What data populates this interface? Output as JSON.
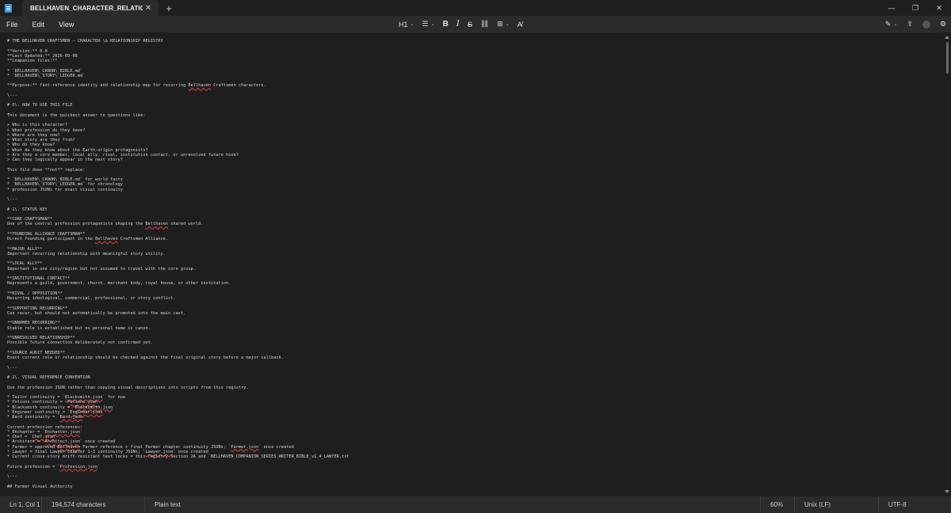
{
  "app": {
    "tab_title": "BELLHAVEN_CHARACTER_RELATIO",
    "close_glyph": "✕",
    "new_tab_glyph": "+",
    "window_controls": [
      "—",
      "❐",
      "✕"
    ]
  },
  "menu": [
    "File",
    "Edit",
    "View"
  ],
  "toolbar": {
    "heading": "H1",
    "list_glyph": "☰",
    "bold": "B",
    "italic": "I",
    "strike": "S",
    "link_glyph": "⛓",
    "table_glyph": "⊞",
    "clear_format_glyph": "A̸",
    "chevron": "⌄"
  },
  "right_tools": {
    "copilot_glyph": "✎",
    "send_glyph": "⇪",
    "account_glyph": "●",
    "settings_glyph": "⚙"
  },
  "document_lines": [
    "# THE BELLHAVEN CRAFTSMEN — CHARACTER \\& RELATIONSHIP REGISTRY",
    "",
    "**Version:** 0.8",
    "**Last Updated:** 2026-09-08",
    "**Companion files:**",
    "",
    "* `BELLHAVEN\\_CANON\\_BIBLE.md`",
    "* `BELLHAVEN\\_STORY\\_LEDGER.md`",
    "",
    "**Purpose:** fast-reference identity and relationship map for recurring Bellhaven Craftsmen characters.",
    "",
    "\\---",
    "",
    "# 0\\. HOW TO USE THIS FILE",
    "",
    "This document is the quickest answer to questions like:",
    "",
    "> Who is this character?",
    "> What profession do they have?",
    "> Where are they now?",
    "> What story are they from?",
    "> Who do they know?",
    "> What do they know about the Earth-origin protagonists?",
    "> Are they a core member, local ally, rival, institution contact, or unresolved future hook?",
    "> Can they logically appear in the next story?",
    "",
    "This file does **not** replace:",
    "",
    "* `BELLHAVEN\\_CANON\\_BIBLE.md` for world facts",
    "* `BELLHAVEN\\_STORY\\_LEDGER.md` for chronology",
    "* profession JSONs for exact visual continuity",
    "",
    "\\---",
    "",
    "# 1\\. STATUS KEY",
    "",
    "**CORE CRAFTSMAN**",
    "One of the central profession protagonists shaping the Bellhaven shared world.",
    "",
    "**FOUNDING ALLIANCE CRAFTSMAN**",
    "Direct founding participant in the Bellhaven Craftsmen Alliance.",
    "",
    "**MAJOR ALLY**",
    "Important recurring relationship with meaningful story utility.",
    "",
    "**LOCAL ALLY**",
    "Important in one city/region but not assumed to travel with the core group.",
    "",
    "**INSTITUTIONAL CONTACT**",
    "Represents a guild, government, church, merchant body, royal house, or other institution.",
    "",
    "**RIVAL / OPPOSITION**",
    "Recurring ideological, commercial, professional, or story conflict.",
    "",
    "**SUPPORTING RECURRING**",
    "Can recur, but should not automatically be promoted into the main cast.",
    "",
    "**UNNAMED RECURRING**",
    "Stable role is established but no personal name is canon.",
    "",
    "**UNRESOLVED RELATIONSHIP**",
    "Possible future connection deliberately not confirmed yet.",
    "",
    "**SOURCE AUDIT NEEDED**",
    "Exact current role or relationship should be checked against the final original story before a major callback.",
    "",
    "\\---",
    "",
    "# 2\\. VISUAL REFERENCE CONVENTION",
    "",
    "Use the profession JSON rather than copying visual descriptions into scripts from this registry.",
    "",
    "* Tailor continuity = `Blacksmith.json` for now",
    "* Potions continuity = `Potions.json`",
    "* Blacksmith continuity = `Blacksmith.json`",
    "* Engineer continuity = `Engineer.json`",
    "* Bard continuity = `Bard.json`",
    "",
    "Current profession references:",
    "* Enchanter = `Enchanter.json`",
    "* Chef = `Chef.json`",
    "* Architect = `Architect.json` once created",
    "* Farmer = approved Bellhaven Farmer reference + final Farmer chapter continuity JSONs; `Farmer.json` once created",
    "* Lawyer = final Lawyer Chapter 1–3 continuity JSONs; `Lawyer.json` once created",
    "* Current cross-story drift-resistant text locks = this registry Section 2A and `BELLHAVEN_COMPANION_SERIES_WRITER_BIBLE_v1.4_LAWYER.txt`",
    "",
    "Future profession = `Profession.json`",
    "",
    "\\---",
    "",
    "## Farmer Visual Authority"
  ],
  "status": {
    "position": "Ln 1, Col 1",
    "characters": "194,574 characters",
    "format": "Plain text",
    "zoom": "60%",
    "line_endings": "Unix (LF)",
    "encoding": "UTF-8"
  }
}
